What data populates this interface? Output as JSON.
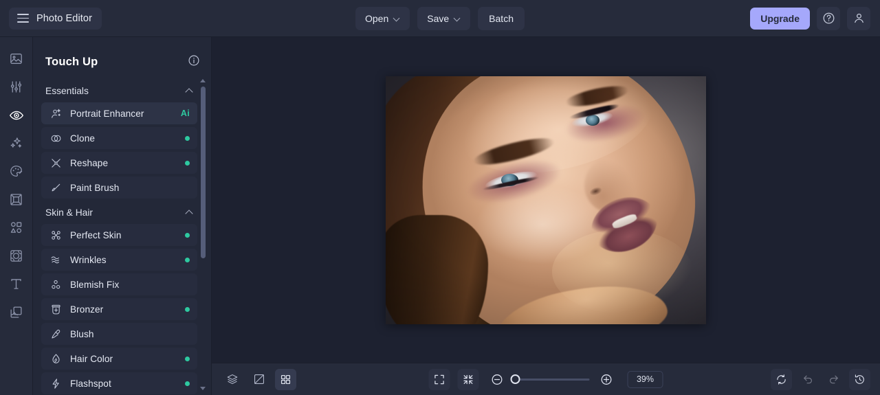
{
  "header": {
    "brand_title": "Photo Editor",
    "menu_icon": "hamburger-icon",
    "buttons": [
      {
        "label": "Open",
        "caret": true
      },
      {
        "label": "Save",
        "caret": true
      },
      {
        "label": "Batch",
        "caret": false
      }
    ],
    "upgrade_label": "Upgrade",
    "help_icon": "question-circle-icon",
    "account_icon": "user-icon"
  },
  "rail": {
    "items": [
      {
        "name": "image-icon",
        "active": false
      },
      {
        "name": "adjust-sliders-icon",
        "active": false
      },
      {
        "name": "eye-retouch-icon",
        "active": true
      },
      {
        "name": "sparkles-effects-icon",
        "active": false
      },
      {
        "name": "palette-icon",
        "active": false
      },
      {
        "name": "frame-icon",
        "active": false
      },
      {
        "name": "shapes-icon",
        "active": false
      },
      {
        "name": "texture-icon",
        "active": false
      },
      {
        "name": "text-icon",
        "active": false
      },
      {
        "name": "layers-overlay-icon",
        "active": false
      }
    ]
  },
  "panel": {
    "title": "Touch Up",
    "info_icon": "info-circle-icon",
    "groups": [
      {
        "label": "Essentials",
        "expanded": true,
        "items": [
          {
            "label": "Portrait Enhancer",
            "icon": "portrait-enhancer-icon",
            "badge": "Ai",
            "dot": false,
            "highlighted": true
          },
          {
            "label": "Clone",
            "icon": "clone-icon",
            "badge": "",
            "dot": true,
            "highlighted": false
          },
          {
            "label": "Reshape",
            "icon": "reshape-icon",
            "badge": "",
            "dot": true,
            "highlighted": false
          },
          {
            "label": "Paint Brush",
            "icon": "paint-brush-icon",
            "badge": "",
            "dot": false,
            "highlighted": false
          }
        ]
      },
      {
        "label": "Skin & Hair",
        "expanded": true,
        "items": [
          {
            "label": "Perfect Skin",
            "icon": "perfect-skin-icon",
            "badge": "",
            "dot": true,
            "highlighted": false
          },
          {
            "label": "Wrinkles",
            "icon": "wrinkles-icon",
            "badge": "",
            "dot": true,
            "highlighted": false
          },
          {
            "label": "Blemish Fix",
            "icon": "blemish-fix-icon",
            "badge": "",
            "dot": false,
            "highlighted": false
          },
          {
            "label": "Bronzer",
            "icon": "bronzer-icon",
            "badge": "",
            "dot": true,
            "highlighted": false
          },
          {
            "label": "Blush",
            "icon": "blush-icon",
            "badge": "",
            "dot": false,
            "highlighted": false
          },
          {
            "label": "Hair Color",
            "icon": "hair-color-icon",
            "badge": "",
            "dot": true,
            "highlighted": false
          },
          {
            "label": "Flashspot",
            "icon": "flashspot-icon",
            "badge": "",
            "dot": true,
            "highlighted": false
          }
        ]
      }
    ],
    "scrollbar": {
      "up_arrow": "scroll-up-arrow",
      "down_arrow": "scroll-down-arrow"
    }
  },
  "canvas": {
    "image_alt": "beauty-portrait-photo"
  },
  "bottombar": {
    "left_icons": [
      {
        "name": "layers-icon",
        "active": false
      },
      {
        "name": "compare-split-icon",
        "active": false
      },
      {
        "name": "grid-view-icon",
        "active": true
      }
    ],
    "center_icons": [
      {
        "name": "fit-to-screen-icon"
      },
      {
        "name": "shrink-to-fit-icon"
      },
      {
        "name": "zoom-out-icon"
      },
      {
        "name": "zoom-in-icon"
      }
    ],
    "zoom_value": "39%",
    "right_icons": [
      {
        "name": "reset-icon",
        "dim": false,
        "active": true
      },
      {
        "name": "undo-icon",
        "dim": true,
        "active": false
      },
      {
        "name": "redo-icon",
        "dim": true,
        "active": false
      },
      {
        "name": "history-icon",
        "dim": false,
        "active": true
      }
    ]
  },
  "colors": {
    "accent_upgrade": "#a5a8fb",
    "status_dot": "#2ec9a0",
    "ai_badge": "#2ec9a0",
    "header_bg": "#262b3b",
    "panel_bg": "#232838",
    "canvas_bg": "#1d2130"
  }
}
